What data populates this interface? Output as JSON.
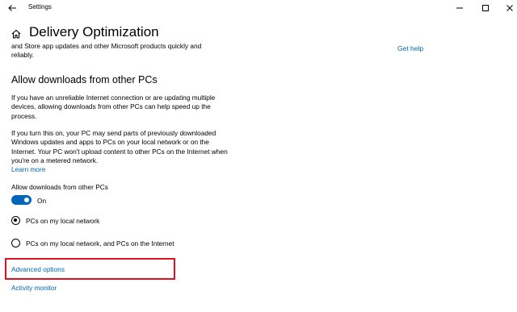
{
  "window": {
    "title": "Settings",
    "controls": [
      "minimize-icon",
      "maximize-icon",
      "close-icon"
    ]
  },
  "page": {
    "title": "Delivery Optimization",
    "intro": "and Store app updates and other Microsoft products quickly and reliably.",
    "get_help": "Get help"
  },
  "section": {
    "heading": "Allow downloads from other PCs",
    "para1": "If you have an unreliable Internet connection or are updating multiple devices, allowing downloads from other PCs can help speed up the process.",
    "para2": "If you turn this on, your PC may send parts of previously downloaded Windows updates and apps to PCs on your local network or on the Internet. Your PC won't upload content to other PCs on the Internet when you're on a metered network.",
    "learn_more": "Learn more"
  },
  "toggle": {
    "label": "Allow downloads from other PCs",
    "state": "On",
    "on": true
  },
  "radios": {
    "local": {
      "label": "PCs on my local network",
      "selected": true
    },
    "internet": {
      "label": "PCs on my local network, and PCs on the Internet",
      "selected": false
    }
  },
  "links": {
    "advanced_options": "Advanced options",
    "activity_monitor": "Activity monitor"
  },
  "colors": {
    "accent": "#0067b8",
    "highlight": "#e0101e"
  }
}
